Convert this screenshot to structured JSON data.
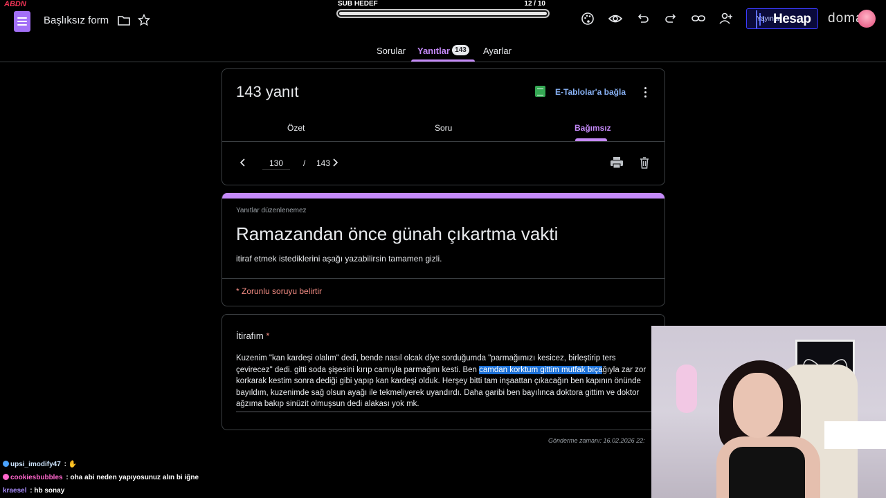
{
  "app": {
    "form_title": "Başlıksız form",
    "logo_text": "ABDN"
  },
  "overlay": {
    "label": "SUB HEDEF",
    "count": "12  / 10",
    "progress": 1.0
  },
  "sponsor": {
    "publish_label": "Yayınla",
    "brand": "Hesap",
    "brand2": "domar"
  },
  "tabs": [
    {
      "label": "Sorular"
    },
    {
      "label": "Yanıtlar",
      "badge": "143"
    },
    {
      "label": "Ayarlar"
    }
  ],
  "responses": {
    "title": "143 yanıt",
    "sheets_label": "E-Tablolar'a bağla",
    "subtabs": [
      "Özet",
      "Soru",
      "Bağımsız"
    ],
    "current": "130",
    "separator": "/",
    "total": "143"
  },
  "form": {
    "no_edit_note": "Yanıtlar düzenlenemez",
    "heading": "Ramazandan önce günah çıkartma vakti",
    "description": "itiraf etmek istediklerini aşağı yazabilirsin tamamen gizli.",
    "required_note": "* Zorunlu soruyu belirtir"
  },
  "question": {
    "title": "İtirafım",
    "required_mark": "*",
    "answer_before": "Kuzenim \"kan kardeşi olalım\" dedi, bende nasıl olcak diye sorduğumda \"parmağımızı kesicez, birleştirip ters çevirecez\" dedi. gitti soda şişesini kırıp camıyla parmağını kesti. Ben ",
    "answer_highlight": "camdan korktum gittim mutfak bıça",
    "answer_after": "ğıyla zar zor korkarak kestim sonra dediği gibi yapıp kan kardeşi olduk. Herşey bitti tam inşaattan çıkacağın ben kapının önünde bayıldım, kuzenimde sağ olsun ayağı ile tekmeliyerek uyandırdı. Daha garibi ben bayılınca doktora gittim ve doktor ağzıma bakıp sinüzit olmuşsun dedi alakası yok mk.",
    "submitted": "Gönderme zamanı: 16.02.2026 22:"
  },
  "chat": [
    {
      "user": "upsi_imodify47",
      "message": "",
      "color": "#4aa3ff"
    },
    {
      "user": "cookiesbubbles",
      "message": "oha abi neden yapıyosunuz alın bi iğne",
      "color": "#ff66cc"
    },
    {
      "user": "kraesel",
      "message": "hb sonay",
      "color": "#a78bfa"
    }
  ],
  "colors": {
    "accent": "#c58af9",
    "link": "#8ab4f8",
    "required": "#f28b82",
    "sheets": "#34a853",
    "highlight": "#1a6fd6"
  }
}
